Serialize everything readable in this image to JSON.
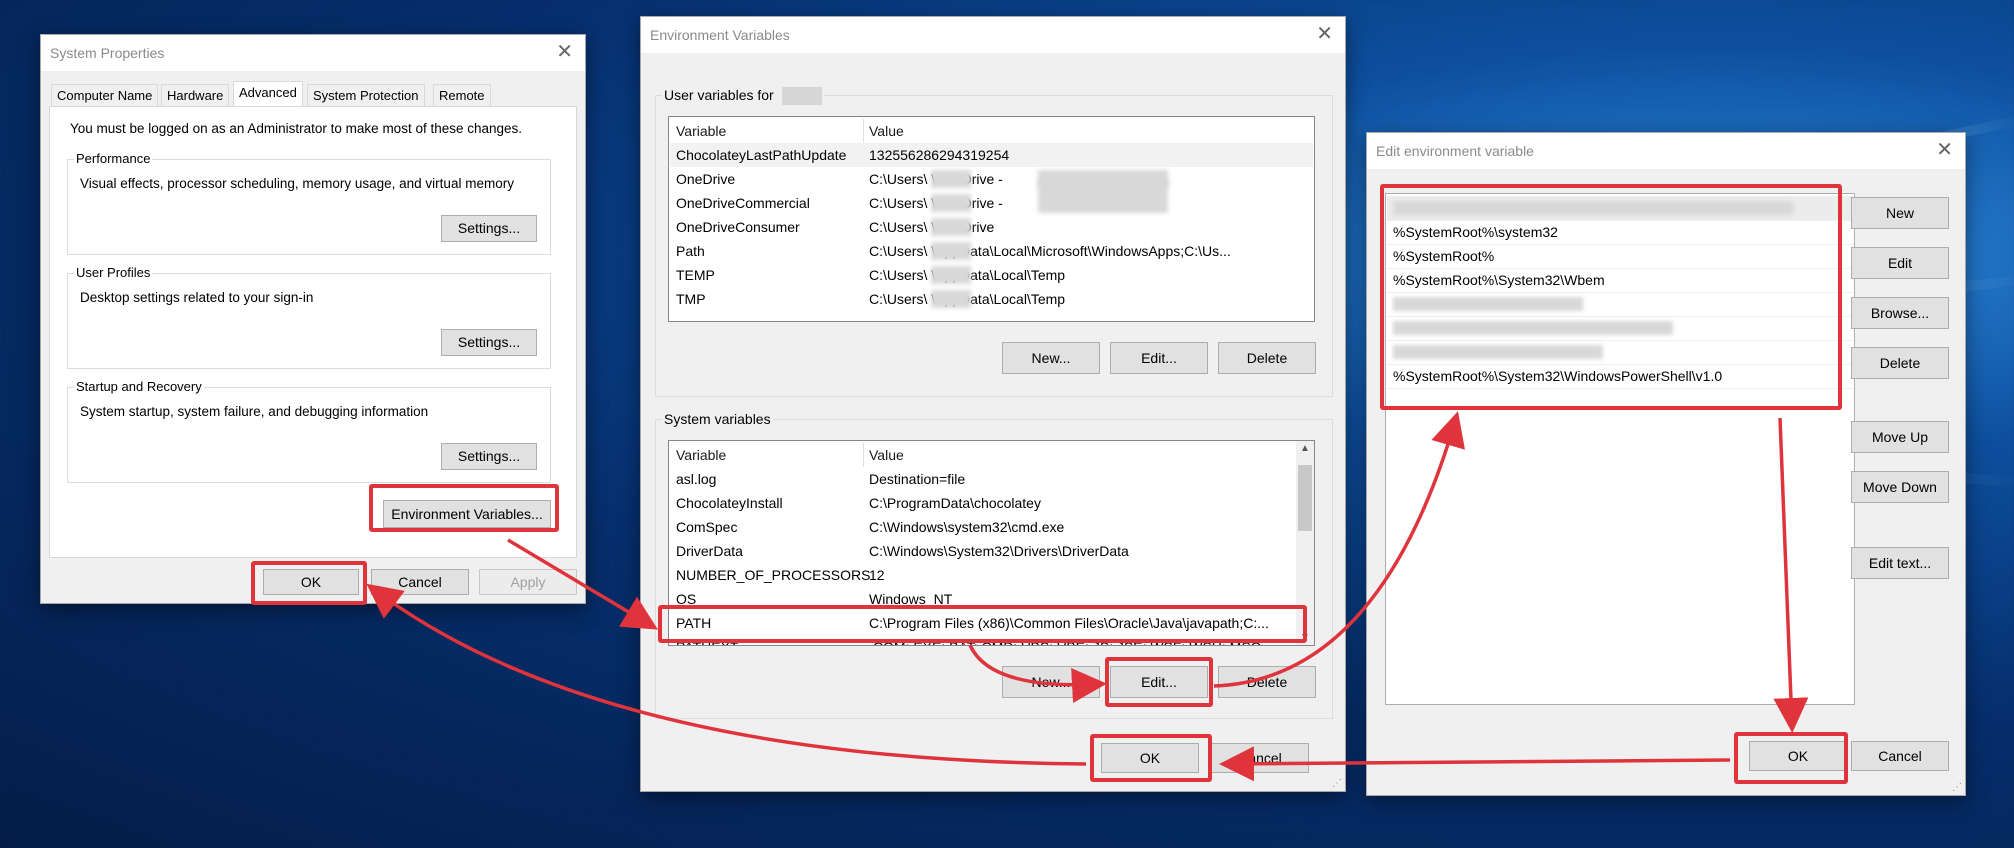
{
  "colors": {
    "annotation_red": "#e0343c",
    "window_bg": "#f0f0f0",
    "desktop_blue": "#0d4f9e"
  },
  "system_properties": {
    "title": "System Properties",
    "tabs": [
      "Computer Name",
      "Hardware",
      "Advanced",
      "System Protection",
      "Remote"
    ],
    "active_tab": "Advanced",
    "admin_note": "You must be logged on as an Administrator to make most of these changes.",
    "performance": {
      "legend": "Performance",
      "description": "Visual effects, processor scheduling, memory usage, and virtual memory",
      "button": "Settings..."
    },
    "user_profiles": {
      "legend": "User Profiles",
      "description": "Desktop settings related to your sign-in",
      "button": "Settings..."
    },
    "startup": {
      "legend": "Startup and Recovery",
      "description": "System startup, system failure, and debugging information",
      "button": "Settings..."
    },
    "env_button": "Environment Variables...",
    "ok": "OK",
    "cancel": "Cancel",
    "apply": "Apply"
  },
  "env_vars": {
    "title": "Environment Variables",
    "user_label": "User variables for",
    "columns": [
      "Variable",
      "Value"
    ],
    "user_rows": [
      [
        "ChocolateyLastPathUpdate",
        "132556286294319254"
      ],
      [
        "OneDrive",
        "C:\\Users\\      \\OneDrive -"
      ],
      [
        "OneDriveCommercial",
        "C:\\Users\\      \\OneDrive -"
      ],
      [
        "OneDriveConsumer",
        "C:\\Users\\      \\OneDrive"
      ],
      [
        "Path",
        "C:\\Users\\      \\AppData\\Local\\Microsoft\\WindowsApps;C:\\Us..."
      ],
      [
        "TEMP",
        "C:\\Users\\      \\AppData\\Local\\Temp"
      ],
      [
        "TMP",
        "C:\\Users\\      \\AppData\\Local\\Temp"
      ]
    ],
    "user_buttons": {
      "new": "New...",
      "edit": "Edit...",
      "delete": "Delete"
    },
    "system_label": "System variables",
    "system_rows": [
      [
        "asl.log",
        "Destination=file"
      ],
      [
        "ChocolateyInstall",
        "C:\\ProgramData\\chocolatey"
      ],
      [
        "ComSpec",
        "C:\\Windows\\system32\\cmd.exe"
      ],
      [
        "DriverData",
        "C:\\Windows\\System32\\Drivers\\DriverData"
      ],
      [
        "NUMBER_OF_PROCESSORS",
        "12"
      ],
      [
        "OS",
        "Windows_NT"
      ],
      [
        "PATH",
        "C:\\Program Files (x86)\\Common Files\\Oracle\\Java\\javapath;C:..."
      ],
      [
        "PATHEXT",
        ".COM;.EXE;.BAT;.CMD;.VBS;.VBE;.JS;.JSE;.WSF;.WSH;.MSC"
      ]
    ],
    "system_buttons": {
      "new": "New...",
      "edit": "Edit...",
      "delete": "Delete"
    },
    "ok": "OK",
    "cancel": "Cancel"
  },
  "edit_env": {
    "title": "Edit environment variable",
    "entries": [
      "",
      "%SystemRoot%\\system32",
      "%SystemRoot%",
      "%SystemRoot%\\System32\\Wbem",
      "",
      "",
      "",
      "%SystemRoot%\\System32\\WindowsPowerShell\\v1.0"
    ],
    "buttons": {
      "new": "New",
      "edit": "Edit",
      "browse": "Browse...",
      "delete": "Delete",
      "move_up": "Move Up",
      "move_down": "Move Down",
      "edit_text": "Edit text..."
    },
    "ok": "OK",
    "cancel": "Cancel"
  }
}
